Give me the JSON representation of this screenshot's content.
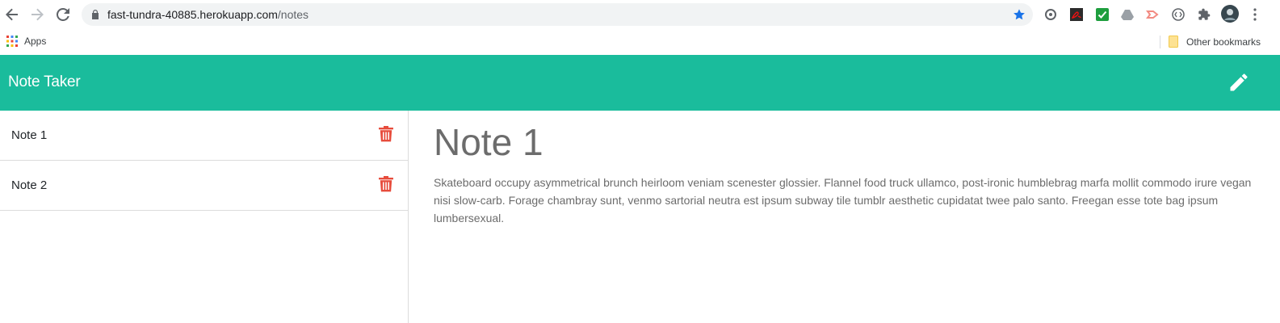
{
  "browser": {
    "url_host": "fast-tundra-40885.herokuapp.com",
    "url_path": "/notes",
    "bookmarks": {
      "apps_label": "Apps",
      "other_label": "Other bookmarks"
    },
    "extensions": [
      "search-extension-icon",
      "pdf-extension-icon",
      "checkmark-extension-icon",
      "drive-extension-icon",
      "red-extension-icon",
      "code-extension-icon",
      "puzzle-extensions-icon",
      "profile-avatar",
      "more-menu-icon"
    ]
  },
  "app": {
    "brand": "Note Taker",
    "colors": {
      "primary": "#1abc9c",
      "danger": "#e74c3c",
      "muted": "#6c6c6c"
    },
    "notes": [
      {
        "title": "Note 1"
      },
      {
        "title": "Note 2"
      }
    ],
    "active_note": {
      "title": "Note 1",
      "text": "Skateboard occupy asymmetrical brunch heirloom veniam scenester glossier. Flannel food truck ullamco, post-ironic humblebrag marfa mollit commodo irure vegan nisi slow-carb. Forage chambray sunt, venmo sartorial neutra est ipsum subway tile tumblr aesthetic cupidatat twee palo santo. Freegan esse tote bag ipsum lumbersexual."
    }
  }
}
